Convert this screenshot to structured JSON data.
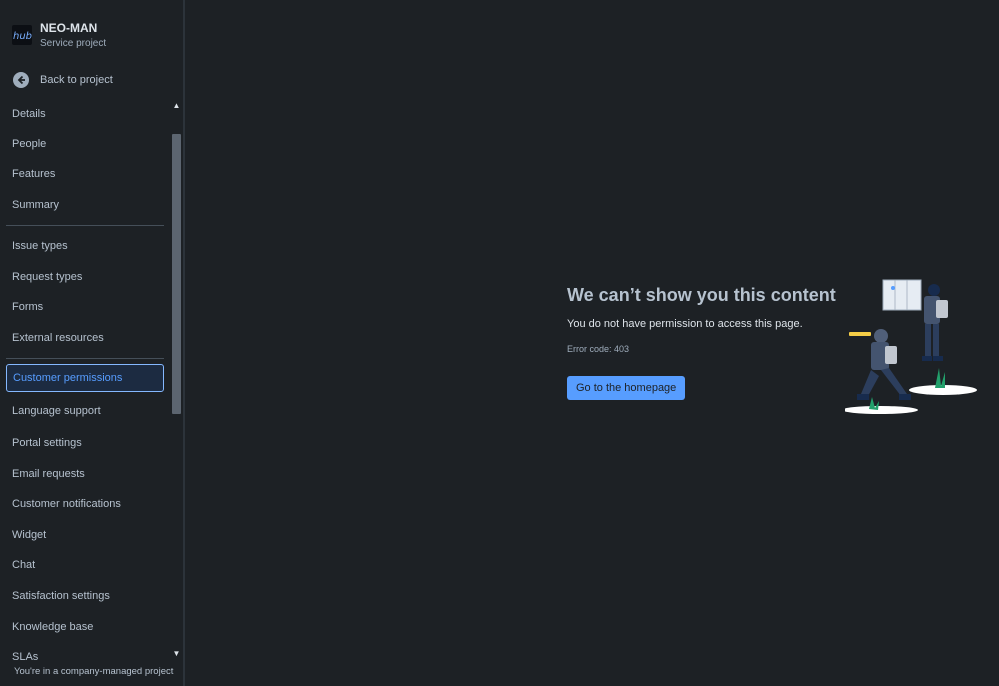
{
  "project": {
    "name": "NEO-MAN",
    "type": "Service project",
    "avatar_text": "hub"
  },
  "back_link": {
    "label": "Back to project",
    "icon": "arrow-left-circle-icon"
  },
  "nav": {
    "items": [
      {
        "label": "Details"
      },
      {
        "label": "People"
      },
      {
        "label": "Features"
      },
      {
        "label": "Summary"
      },
      {
        "label": "Issue types"
      },
      {
        "label": "Request types"
      },
      {
        "label": "Forms"
      },
      {
        "label": "External resources"
      },
      {
        "label": "Customer permissions",
        "active": true
      },
      {
        "label": "Language support"
      },
      {
        "label": "Portal settings"
      },
      {
        "label": "Email requests"
      },
      {
        "label": "Customer notifications"
      },
      {
        "label": "Widget"
      },
      {
        "label": "Chat"
      },
      {
        "label": "Satisfaction settings"
      },
      {
        "label": "Knowledge base"
      },
      {
        "label": "SLAs"
      }
    ]
  },
  "footer_note": "You're in a company-managed project",
  "error": {
    "title": "We can’t show you this content",
    "message": "You do not have permission to access this page.",
    "code": "Error code: 403",
    "button_label": "Go to the homepage"
  },
  "colors": {
    "background": "#1d2125",
    "text": "#b6c2cf",
    "accent": "#579dff",
    "active_border": "#85b8ff"
  }
}
